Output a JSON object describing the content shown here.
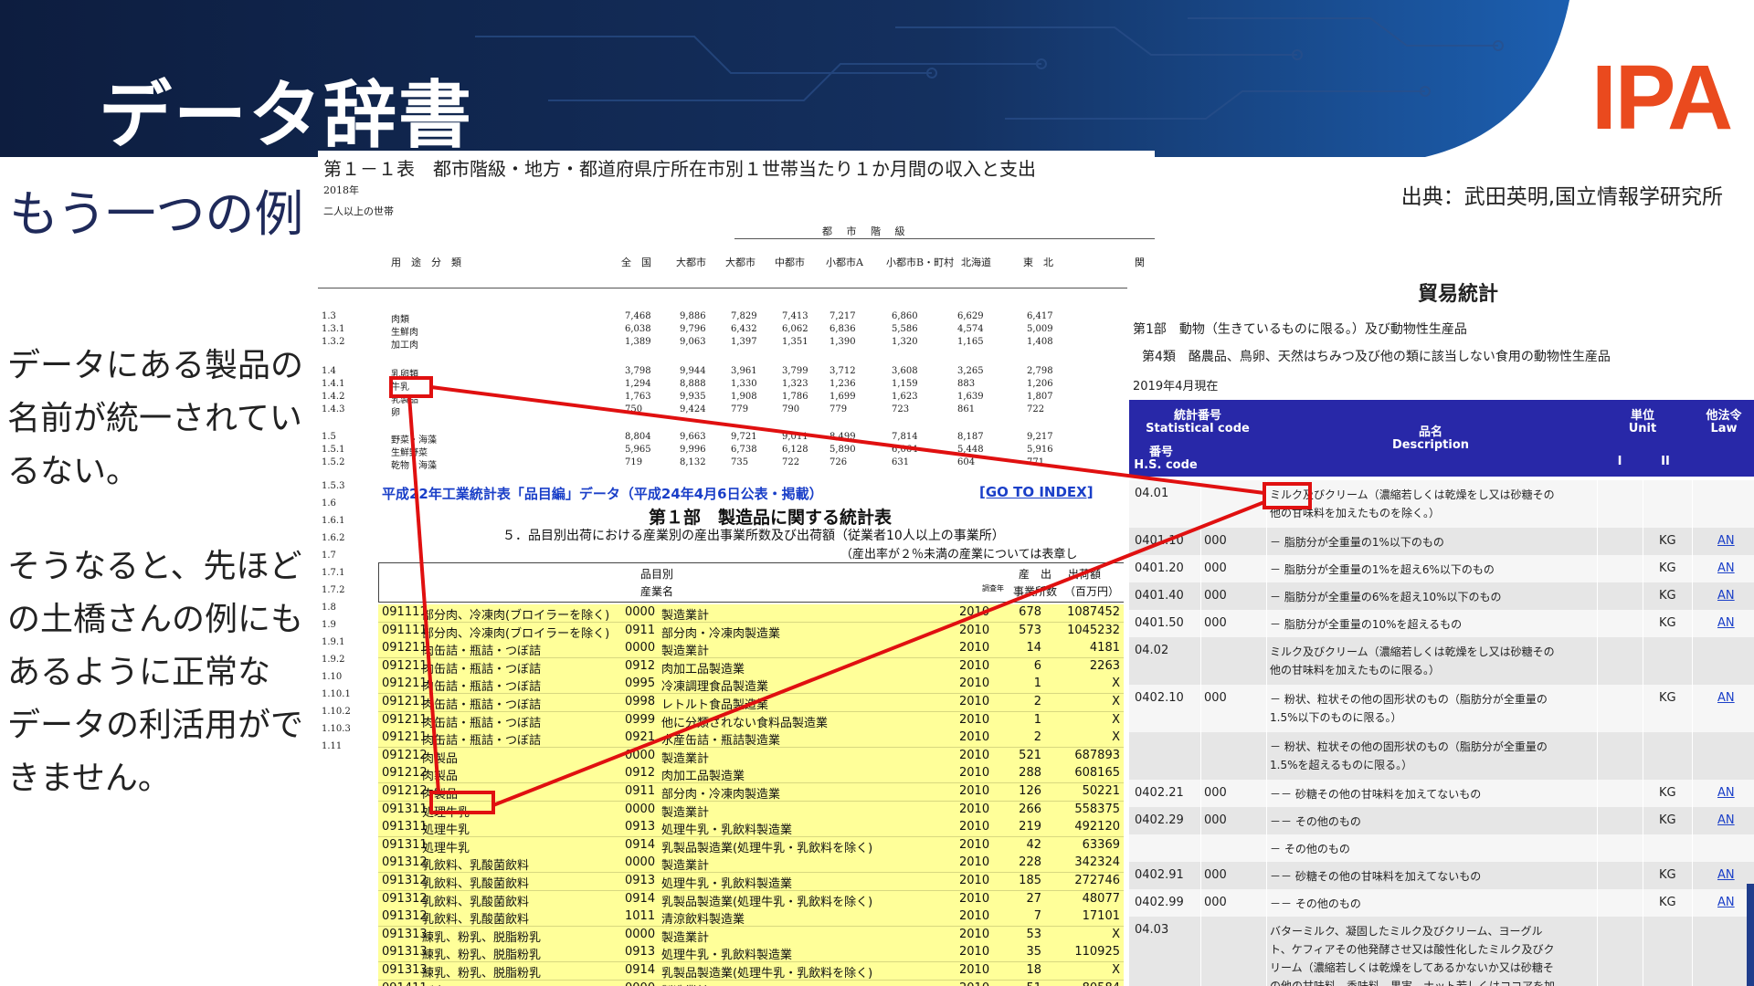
{
  "slide": {
    "title": "データ辞書",
    "logo": "IPA",
    "subtitle": "もう一つの例",
    "source": "出典：武田英明,国立情報学研究所",
    "paragraph1": [
      "データにある製品の",
      "名前が統一されてい",
      "るない。"
    ],
    "paragraph2": [
      "そうなると、先ほど",
      "の土橋さんの例にも",
      "あるように正常な",
      "データの利活用がで",
      "きません。"
    ]
  },
  "colors": {
    "header_bg": "#0f2147",
    "logo": "#ea4a1e",
    "highlight_box": "#e01010",
    "yellow": "#ffff99",
    "trade_header": "#2828a8"
  },
  "household_table": {
    "title": "第１－１表　都市階級・地方・都道府県庁所在市別１世帯当たり１か月間の収入と支出",
    "year": "2018年",
    "subtitle": "二人以上の世帯",
    "group_header": "都 市 階 級",
    "columns": [
      "用　途　分　類",
      "全　国",
      "大都市",
      "大都市",
      "中都市",
      "小都市A",
      "小都市B・町村",
      "北海道",
      "東　北",
      "関"
    ],
    "rows": [
      {
        "code": "1.3",
        "name": "肉類",
        "vals": [
          "7,468",
          "9,886",
          "7,829",
          "7,413",
          "7,217",
          "6,860",
          "6,629",
          "6,417"
        ]
      },
      {
        "code": "1.3.1",
        "name": "生鮮肉",
        "vals": [
          "6,038",
          "9,796",
          "6,432",
          "6,062",
          "6,836",
          "5,586",
          "4,574",
          "5,009"
        ]
      },
      {
        "code": "1.3.2",
        "name": "加工肉",
        "vals": [
          "1,389",
          "9,063",
          "1,397",
          "1,351",
          "1,390",
          "1,320",
          "1,165",
          "1,408"
        ]
      },
      {
        "code": "1.4",
        "name": "乳卵類",
        "vals": [
          "3,798",
          "9,944",
          "3,961",
          "3,799",
          "3,712",
          "3,608",
          "3,265",
          "2,798"
        ]
      },
      {
        "code": "1.4.1",
        "name": "牛乳",
        "vals": [
          "1,294",
          "8,888",
          "1,330",
          "1,323",
          "1,236",
          "1,159",
          "883",
          "1,206"
        ]
      },
      {
        "code": "1.4.2",
        "name": "乳製品",
        "vals": [
          "1,763",
          "9,935",
          "1,908",
          "1,786",
          "1,699",
          "1,623",
          "1,639",
          "1,807"
        ]
      },
      {
        "code": "1.4.3",
        "name": "卵",
        "vals": [
          "750",
          "9,424",
          "779",
          "790",
          "779",
          "723",
          "861",
          "722"
        ]
      },
      {
        "code": "1.5",
        "name": "野菜・海藻",
        "vals": [
          "8,804",
          "9,663",
          "9,721",
          "9,011",
          "8,499",
          "7,814",
          "8,187",
          "9,217"
        ]
      },
      {
        "code": "1.5.1",
        "name": "生鮮野菜",
        "vals": [
          "5,965",
          "9,996",
          "6,738",
          "6,128",
          "5,890",
          "6,064",
          "5,448",
          "5,916"
        ]
      },
      {
        "code": "1.5.2",
        "name": "乾物・海藻",
        "vals": [
          "719",
          "8,132",
          "735",
          "722",
          "726",
          "631",
          "604",
          "771"
        ]
      }
    ],
    "more_codes": [
      "1.5.3",
      "1.6",
      "1.6.1",
      "1.6.2",
      "1.7",
      "1.7.1",
      "1.7.2",
      "1.8",
      "1.9",
      "1.9.1",
      "1.9.2",
      "1.10",
      "1.10.1",
      "1.10.2",
      "1.10.3",
      "1.11"
    ]
  },
  "industry_table": {
    "heading": "平成22年工業統計表「品目編」データ（平成24年4月6日公表・掲載）",
    "index_link": "[GO TO INDEX]",
    "part": "第１部　製造品に関する統計表",
    "section": "５．品目別出荷における産業別の産出事業所数及び出荷額（従業者10人以上の事業所）",
    "note": "（産出率が２％未満の産業については表章し",
    "headers": {
      "item": "品目別",
      "industry": "産業名",
      "year": "調査年",
      "count_top": "産　出",
      "count": "事業所数",
      "amount_top": "出荷額",
      "amount": "（百万円）"
    },
    "rows": [
      {
        "code": "091111",
        "item": "部分肉、冷凍肉(ブロイラーを除く)",
        "icode": "0000",
        "industry": "製造業計",
        "year": "2010",
        "count": "678",
        "amount": "1087452"
      },
      {
        "code": "091111",
        "item": "部分肉、冷凍肉(ブロイラーを除く)",
        "icode": "0911",
        "industry": "部分肉・冷凍肉製造業",
        "year": "2010",
        "count": "573",
        "amount": "1045232"
      },
      {
        "code": "091211",
        "item": "肉缶詰・瓶詰・つぼ詰",
        "icode": "0000",
        "industry": "製造業計",
        "year": "2010",
        "count": "14",
        "amount": "4181"
      },
      {
        "code": "091211",
        "item": "肉缶詰・瓶詰・つぼ詰",
        "icode": "0912",
        "industry": "肉加工品製造業",
        "year": "2010",
        "count": "6",
        "amount": "2263"
      },
      {
        "code": "091211",
        "item": "肉缶詰・瓶詰・つぼ詰",
        "icode": "0995",
        "industry": "冷凍調理食品製造業",
        "year": "2010",
        "count": "1",
        "amount": "X"
      },
      {
        "code": "091211",
        "item": "肉缶詰・瓶詰・つぼ詰",
        "icode": "0998",
        "industry": "レトルト食品製造業",
        "year": "2010",
        "count": "2",
        "amount": "X"
      },
      {
        "code": "091211",
        "item": "肉缶詰・瓶詰・つぼ詰",
        "icode": "0999",
        "industry": "他に分類されない食料品製造業",
        "year": "2010",
        "count": "1",
        "amount": "X"
      },
      {
        "code": "091211",
        "item": "肉缶詰・瓶詰・つぼ詰",
        "icode": "0921",
        "industry": "水産缶詰・瓶詰製造業",
        "year": "2010",
        "count": "2",
        "amount": "X"
      },
      {
        "code": "091212",
        "item": "肉製品",
        "icode": "0000",
        "industry": "製造業計",
        "year": "2010",
        "count": "521",
        "amount": "687893"
      },
      {
        "code": "091212",
        "item": "肉製品",
        "icode": "0912",
        "industry": "肉加工品製造業",
        "year": "2010",
        "count": "288",
        "amount": "608165"
      },
      {
        "code": "091212",
        "item": "肉製品",
        "icode": "0911",
        "industry": "部分肉・冷凍肉製造業",
        "year": "2010",
        "count": "126",
        "amount": "50221"
      },
      {
        "code": "091311",
        "item": "処理牛乳",
        "icode": "0000",
        "industry": "製造業計",
        "year": "2010",
        "count": "266",
        "amount": "558375"
      },
      {
        "code": "091311",
        "item": "処理牛乳",
        "icode": "0913",
        "industry": "処理牛乳・乳飲料製造業",
        "year": "2010",
        "count": "219",
        "amount": "492120"
      },
      {
        "code": "091311",
        "item": "処理牛乳",
        "icode": "0914",
        "industry": "乳製品製造業(処理牛乳・乳飲料を除く)",
        "year": "2010",
        "count": "42",
        "amount": "63369"
      },
      {
        "code": "091312",
        "item": "乳飲料、乳酸菌飲料",
        "icode": "0000",
        "industry": "製造業計",
        "year": "2010",
        "count": "228",
        "amount": "342324"
      },
      {
        "code": "091312",
        "item": "乳飲料、乳酸菌飲料",
        "icode": "0913",
        "industry": "処理牛乳・乳飲料製造業",
        "year": "2010",
        "count": "185",
        "amount": "272746"
      },
      {
        "code": "091312",
        "item": "乳飲料、乳酸菌飲料",
        "icode": "0914",
        "industry": "乳製品製造業(処理牛乳・乳飲料を除く)",
        "year": "2010",
        "count": "27",
        "amount": "48077"
      },
      {
        "code": "091312",
        "item": "乳飲料、乳酸菌飲料",
        "icode": "1011",
        "industry": "清涼飲料製造業",
        "year": "2010",
        "count": "7",
        "amount": "17101"
      },
      {
        "code": "091313",
        "item": "練乳、粉乳、脱脂粉乳",
        "icode": "0000",
        "industry": "製造業計",
        "year": "2010",
        "count": "53",
        "amount": "X"
      },
      {
        "code": "091313",
        "item": "練乳、粉乳、脱脂粉乳",
        "icode": "0913",
        "industry": "処理牛乳・乳飲料製造業",
        "year": "2010",
        "count": "35",
        "amount": "110925"
      },
      {
        "code": "091313",
        "item": "練乳、粉乳、脱脂粉乳",
        "icode": "0914",
        "industry": "乳製品製造業(処理牛乳・乳飲料を除く)",
        "year": "2010",
        "count": "18",
        "amount": "X"
      },
      {
        "code": "091411",
        "item": "バター",
        "icode": "0000",
        "industry": "製造業計",
        "year": "2010",
        "count": "51",
        "amount": "80584"
      }
    ]
  },
  "trade_table": {
    "title": "貿易統計",
    "chapter": "第1部　動物（生きているものに限る。）及び動物性生産品",
    "section": "第4類　酪農品、鳥卵、天然はちみつ及び他の類に該当しない食用の動物性生産品",
    "date": "2019年4月現在",
    "headers": {
      "stat_jp": "統計番号",
      "stat_en": "Statistical code",
      "hs_jp": "番号",
      "hs_en": "H.S. code",
      "desc_jp": "品名",
      "desc_en": "Description",
      "unit_jp": "単位",
      "unit_en": "Unit",
      "unit1": "I",
      "unit2": "II",
      "law_jp": "他法令",
      "law_en": "Law"
    },
    "rows": [
      {
        "hs": "04.01",
        "stat": "",
        "desc": [
          "ミルク及びクリーム（濃縮若しくは乾燥をし又は砂糖その",
          "他の甘味料を加えたものを除く。）"
        ],
        "unit": "",
        "law": "",
        "shade": false
      },
      {
        "hs": "0401.10",
        "stat": "000",
        "desc": [
          "－ 脂肪分が全重量の1%以下のもの"
        ],
        "unit": "KG",
        "law": "AN",
        "shade": true
      },
      {
        "hs": "0401.20",
        "stat": "000",
        "desc": [
          "－ 脂肪分が全重量の1%を超え6%以下のもの"
        ],
        "unit": "KG",
        "law": "AN",
        "shade": false
      },
      {
        "hs": "0401.40",
        "stat": "000",
        "desc": [
          "－ 脂肪分が全重量の6%を超え10%以下のもの"
        ],
        "unit": "KG",
        "law": "AN",
        "shade": true
      },
      {
        "hs": "0401.50",
        "stat": "000",
        "desc": [
          "－ 脂肪分が全重量の10%を超えるもの"
        ],
        "unit": "KG",
        "law": "AN",
        "shade": false
      },
      {
        "hs": "04.02",
        "stat": "",
        "desc": [
          "ミルク及びクリーム（濃縮若しくは乾燥をし又は砂糖その",
          "他の甘味料を加えたものに限る。）"
        ],
        "unit": "",
        "law": "",
        "shade": true
      },
      {
        "hs": "0402.10",
        "stat": "000",
        "desc": [
          "－ 粉状、粒状その他の固形状のもの（脂肪分が全重量の",
          "1.5%以下のものに限る。）"
        ],
        "unit": "KG",
        "law": "AN",
        "shade": false
      },
      {
        "hs": "",
        "stat": "",
        "desc": [
          "－ 粉状、粒状その他の固形状のもの（脂肪分が全重量の",
          "1.5%を超えるものに限る。）"
        ],
        "unit": "",
        "law": "",
        "shade": true
      },
      {
        "hs": "0402.21",
        "stat": "000",
        "desc": [
          "－－ 砂糖その他の甘味料を加えてないもの"
        ],
        "unit": "KG",
        "law": "AN",
        "shade": false
      },
      {
        "hs": "0402.29",
        "stat": "000",
        "desc": [
          "－－ その他のもの"
        ],
        "unit": "KG",
        "law": "AN",
        "shade": true
      },
      {
        "hs": "",
        "stat": "",
        "desc": [
          "－ その他のもの"
        ],
        "unit": "",
        "law": "",
        "shade": false
      },
      {
        "hs": "0402.91",
        "stat": "000",
        "desc": [
          "－－ 砂糖その他の甘味料を加えてないもの"
        ],
        "unit": "KG",
        "law": "AN",
        "shade": true
      },
      {
        "hs": "0402.99",
        "stat": "000",
        "desc": [
          "－－ その他のもの"
        ],
        "unit": "KG",
        "law": "AN",
        "shade": false
      },
      {
        "hs": "04.03",
        "stat": "",
        "desc": [
          "バターミルク、凝固したミルク及びクリーム、ヨーグル",
          "ト、ケフィアその他発酵させ又は酸性化したミルク及びク",
          "リーム（濃縮若しくは乾燥をしてあるかないか又は砂糖そ",
          "の他の甘味料、香味料、果実、ナット若しくはココアを加"
        ],
        "unit": "",
        "law": "",
        "shade": true
      }
    ]
  }
}
